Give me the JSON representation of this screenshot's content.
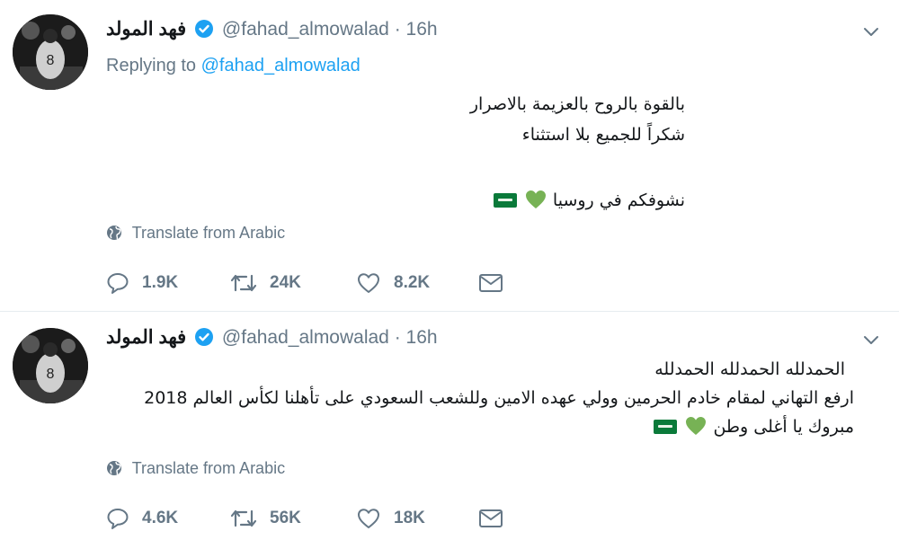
{
  "tweets": [
    {
      "name": "فهد المولد",
      "handle": "@fahad_almowalad",
      "separator": "·",
      "time": "16h",
      "replying_prefix": "Replying to",
      "replying_to": "@fahad_almowalad",
      "lines": [
        "بالقوة بالروح بالعزيمة بالاصرار",
        "شكراً للجميع بلا استثناء",
        "",
        "نشوفكم في روسيا"
      ],
      "translate": "Translate from Arabic",
      "counts": {
        "reply": "1.9K",
        "retweet": "24K",
        "like": "8.2K"
      }
    },
    {
      "name": "فهد المولد",
      "handle": "@fahad_almowalad",
      "separator": "·",
      "time": "16h",
      "lines": [
        "الحمدلله الحمدلله الحمدلله",
        "ارفع التهاني لمقام خادم الحرمين وولي عهده الامين وللشعب السعودي على تأهلنا لكأس العالم 2018",
        "مبروك يا أغلى وطن"
      ],
      "translate": "Translate from Arabic",
      "counts": {
        "reply": "4.6K",
        "retweet": "56K",
        "like": "18K"
      }
    }
  ],
  "colors": {
    "text": "#14171a",
    "secondary": "#657786",
    "link": "#1da1f2",
    "verified": "#1da1f2",
    "heart_emoji": "#77b255",
    "flag": "#0a7a3a"
  },
  "icons": [
    "verified-icon",
    "chevron-down-icon",
    "globe-icon",
    "reply-icon",
    "retweet-icon",
    "like-icon",
    "message-icon",
    "green-heart-emoji",
    "saudi-flag-emoji"
  ]
}
